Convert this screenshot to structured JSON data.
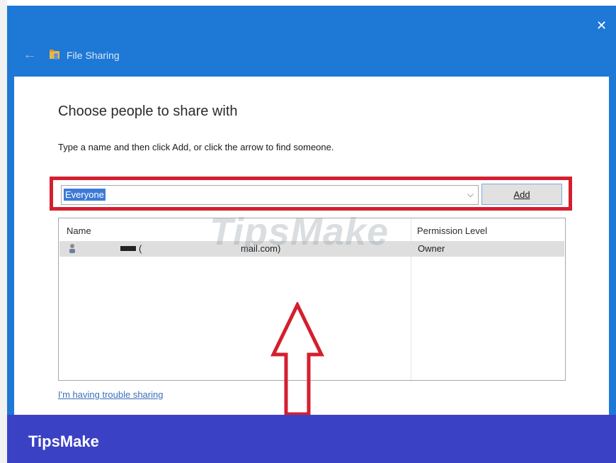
{
  "window": {
    "title": "File Sharing",
    "back_icon": "back-arrow-icon",
    "app_icon": "file-sharing-icon",
    "close_icon": "close-icon",
    "accent_color": "#1e78d6"
  },
  "dialog": {
    "heading": "Choose people to share with",
    "instruction": "Type a name and then click Add, or click the arrow to find someone.",
    "name_input_value": "Everyone",
    "add_button_label": "Add",
    "highlight_color": "#d41f2e"
  },
  "people_list": {
    "columns": [
      "Name",
      "Permission Level"
    ],
    "rows": [
      {
        "name_part_1": "(",
        "name_part_2": "mail.com)",
        "permission": "Owner"
      }
    ]
  },
  "trouble_link": "I'm having trouble sharing",
  "watermark": "TipsMake",
  "footer": {
    "brand": "TipsMake",
    "color": "#3b41c4"
  }
}
